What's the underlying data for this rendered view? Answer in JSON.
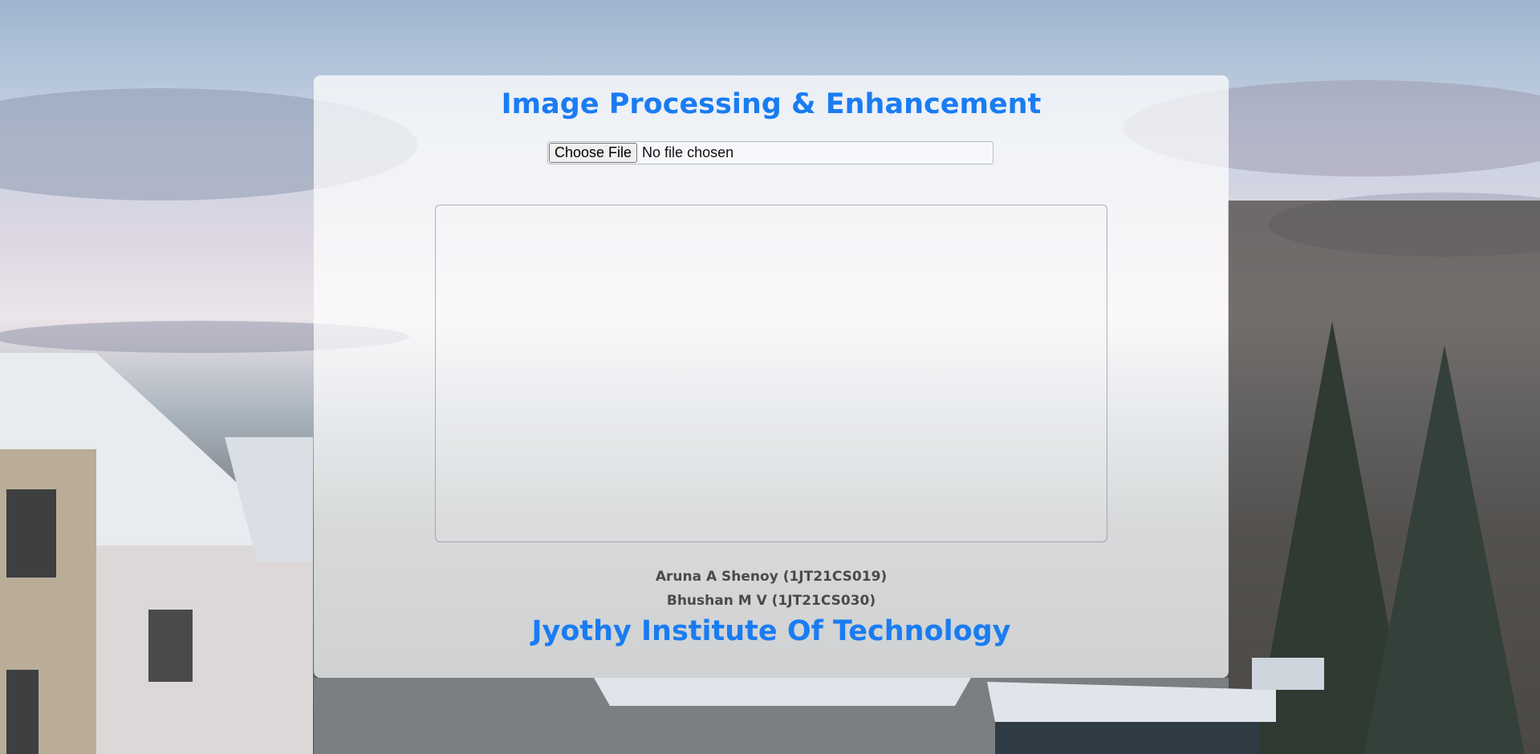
{
  "header": {
    "title": "Image Processing & Enhancement"
  },
  "upload": {
    "button_label": "Choose File",
    "status": "No file chosen"
  },
  "authors": [
    "Aruna A Shenoy (1JT21CS019)",
    "Bhushan M V (1JT21CS030)"
  ],
  "footer": {
    "institute": "Jyothy Institute Of Technology"
  },
  "colors": {
    "accent": "#1a7cf2",
    "author_text": "#4a4a4a"
  }
}
